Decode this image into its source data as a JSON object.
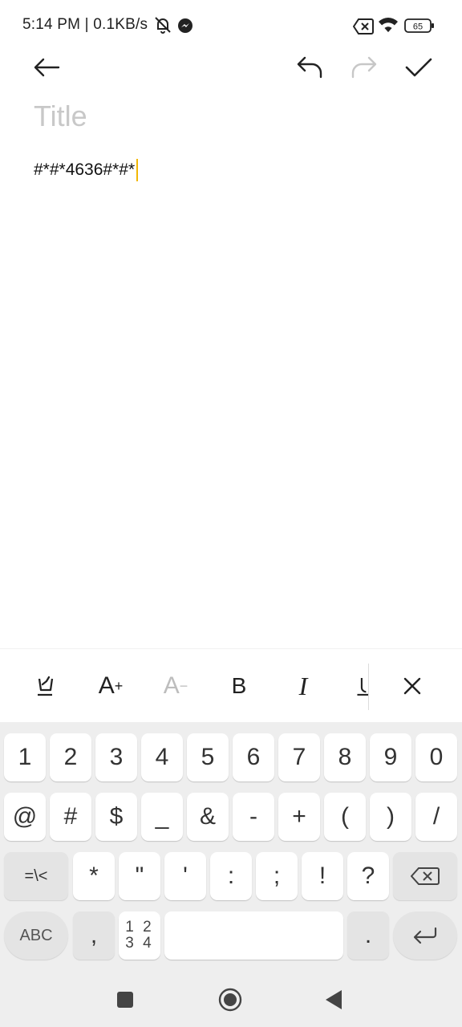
{
  "status_bar": {
    "time_speed": "5:14 PM | 0.1KB/s",
    "battery_level": "65",
    "icons": [
      "mute-icon",
      "messenger-icon",
      "sim-off-icon",
      "wifi-icon",
      "battery-icon"
    ]
  },
  "editor": {
    "title_placeholder": "Title",
    "body_text": "#*#*4636#*#*"
  },
  "toolbar": {
    "icons": [
      "back-arrow-icon",
      "undo-icon",
      "redo-icon",
      "check-icon"
    ]
  },
  "format_bar": {
    "increase_font": "A",
    "increase_sup": "+",
    "decrease_font": "A",
    "decrease_sup": "−",
    "bold": "B",
    "italic": "I",
    "icons": [
      "highlight-icon",
      "underline-icon",
      "close-icon"
    ]
  },
  "keyboard": {
    "row1": [
      "1",
      "2",
      "3",
      "4",
      "5",
      "6",
      "7",
      "8",
      "9",
      "0"
    ],
    "row2": [
      "@",
      "#",
      "$",
      "_",
      "&",
      "-",
      "+",
      "(",
      ")",
      "/"
    ],
    "row3_mode": "=\\<",
    "row3": [
      "*",
      "\"",
      "'",
      ":",
      ";",
      "!",
      "?"
    ],
    "abc_label": "ABC",
    "comma": ",",
    "numpad_line1": "1 2",
    "numpad_line2": "3 4",
    "period": "."
  },
  "nav_bar": {
    "icons": [
      "recents-icon",
      "home-icon",
      "back-icon"
    ]
  },
  "colors": {
    "caret": "#f2b705",
    "title_placeholder": "#c8c8c8",
    "keyboard_bg": "#eeeeee"
  }
}
